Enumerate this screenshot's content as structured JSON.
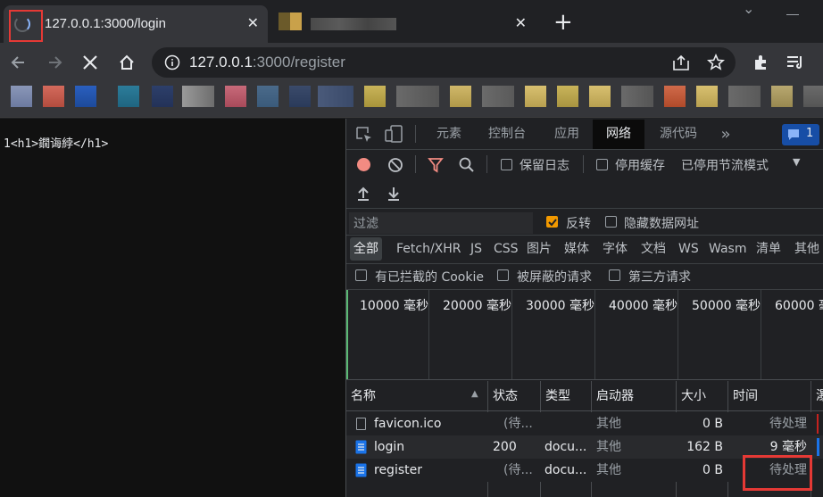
{
  "browser": {
    "tabs": [
      {
        "title": "127.0.0.1:3000/login",
        "active": true,
        "close": "✕"
      },
      {
        "title": "",
        "active": false,
        "close": "✕"
      }
    ],
    "new_tab": "+",
    "window_menu": "⌄",
    "url": {
      "host": "127.0.0.1",
      "path": ":3000/register"
    }
  },
  "page": {
    "text": "1<h1>鐗诲綍</h1>"
  },
  "devtools": {
    "tabs": [
      "元素",
      "控制台",
      "应用",
      "网络",
      "源代码"
    ],
    "active_tab": "网络",
    "more": "»",
    "issues_count": "1",
    "toolbar": {
      "preserve_log": "保留日志",
      "disable_cache": "停用缓存",
      "throttling": "已停用节流模式"
    },
    "filter": {
      "placeholder": "过滤",
      "invert": "反转",
      "hide_data_urls": "隐藏数据网址"
    },
    "types": [
      "全部",
      "Fetch/XHR",
      "JS",
      "CSS",
      "图片",
      "媒体",
      "字体",
      "文档",
      "WS",
      "Wasm",
      "清单",
      "其他"
    ],
    "blocked": {
      "blocked_cookies": "有已拦截的 Cookie",
      "blocked_requests": "被屏蔽的请求",
      "third_party": "第三方请求"
    },
    "waterfall_ticks": [
      "10000 毫秒",
      "20000 毫秒",
      "30000 毫秒",
      "40000 毫秒",
      "50000 毫秒",
      "60000 毫"
    ],
    "columns": [
      "名称",
      "状态",
      "类型",
      "启动器",
      "大小",
      "时间",
      "瀑"
    ],
    "requests": [
      {
        "name": "favicon.ico",
        "status": "(待...",
        "type": "",
        "initiator": "其他",
        "size": "0 B",
        "time": "待处理"
      },
      {
        "name": "login",
        "status": "200",
        "type": "docu...",
        "initiator": "其他",
        "size": "162 B",
        "time": "9 毫秒"
      },
      {
        "name": "register",
        "status": "(待...",
        "type": "docu...",
        "initiator": "其他",
        "size": "0 B",
        "time": "待处理"
      }
    ]
  },
  "colors": {
    "highlight": "#e53935",
    "accent": "#8ab4f8",
    "record": "#f28b82",
    "filter_icon": "#f28b82",
    "checked": "#f29900"
  }
}
